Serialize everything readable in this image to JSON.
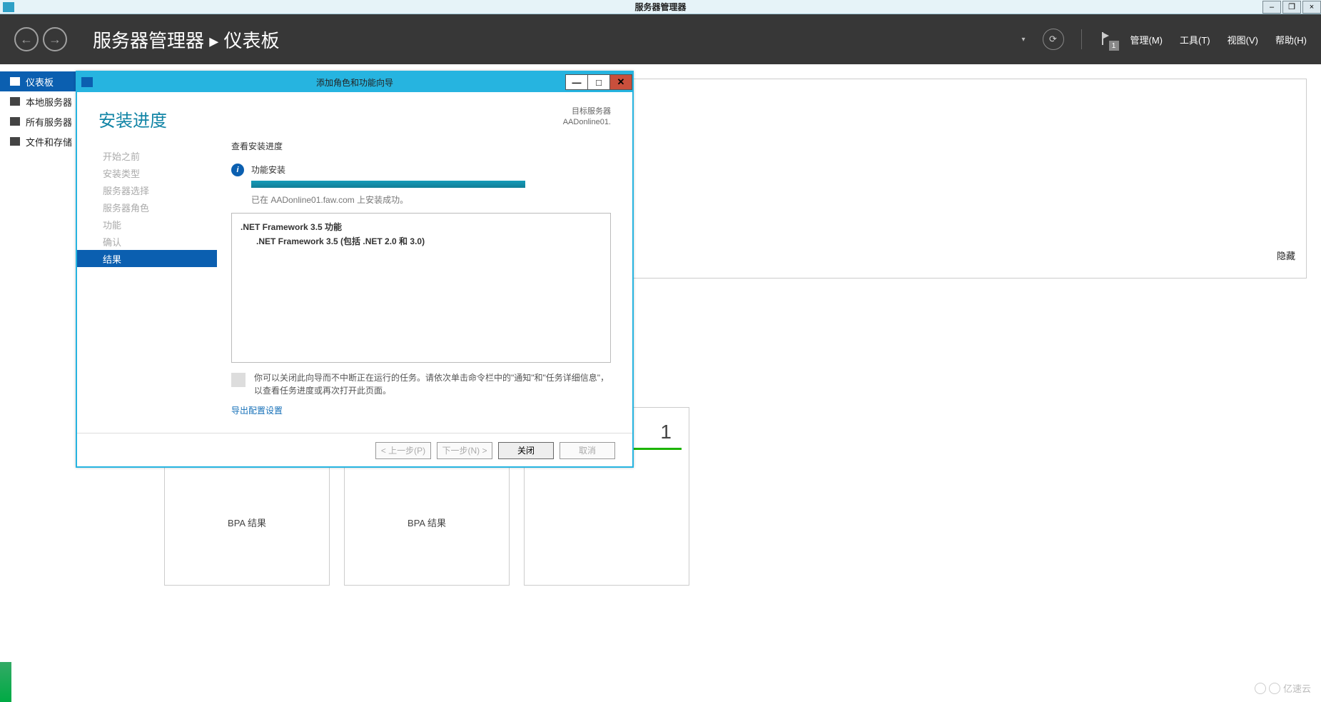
{
  "titlebar": {
    "title": "服务器管理器",
    "min": "–",
    "max": "❐",
    "close": "×"
  },
  "header": {
    "breadcrumb_app": "服务器管理器",
    "breadcrumb_sep": "▸",
    "breadcrumb_page": "仪表板",
    "flag_badge": "1",
    "menu": {
      "manage": "管理(M)",
      "tools": "工具(T)",
      "view": "视图(V)",
      "help": "帮助(H)"
    }
  },
  "sidebar": {
    "items": [
      {
        "label": "仪表板"
      },
      {
        "label": "本地服务器"
      },
      {
        "label": "所有服务器"
      },
      {
        "label": "文件和存储"
      }
    ]
  },
  "main": {
    "hide": "隐藏",
    "bpa": "BPA 结果",
    "tile_num": "1"
  },
  "wizard": {
    "title": "添加角色和功能向导",
    "heading": "安装进度",
    "target_label": "目标服务器",
    "target_value": "AADonline01.",
    "steps": [
      "开始之前",
      "安装类型",
      "服务器选择",
      "服务器角色",
      "功能",
      "确认",
      "结果"
    ],
    "view_progress": "查看安装进度",
    "feature_install": "功能安装",
    "success_msg": "已在 AADonline01.faw.com 上安装成功。",
    "result_l1": ".NET Framework 3.5 功能",
    "result_l2": ".NET Framework 3.5 (包括 .NET 2.0 和 3.0)",
    "note": "你可以关闭此向导而不中断正在运行的任务。请依次单击命令栏中的\"通知\"和\"任务详细信息\"，以查看任务进度或再次打开此页面。",
    "export": "导出配置设置",
    "buttons": {
      "prev": "< 上一步(P)",
      "next": "下一步(N) >",
      "close": "关闭",
      "cancel": "取消"
    }
  },
  "watermark": "亿速云"
}
